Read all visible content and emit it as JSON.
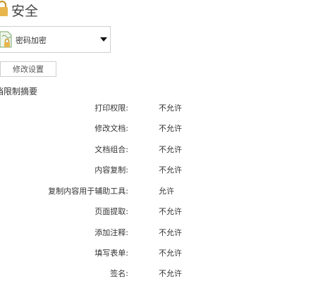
{
  "header": {
    "icon": "lock-icon",
    "title": "安全"
  },
  "security_method": {
    "icon": "document-lock-icon",
    "selected": "密码加密",
    "caret_icon": "caret-down-icon"
  },
  "modify_button": {
    "label": "修改设置"
  },
  "summary": {
    "heading": "档限制摘要",
    "rows": [
      {
        "label": "打印权限:",
        "value": "不允许"
      },
      {
        "label": "修改文档:",
        "value": "不允许"
      },
      {
        "label": "文档组合:",
        "value": "不允许"
      },
      {
        "label": "内容复制:",
        "value": "不允许"
      },
      {
        "label": "复制内容用于辅助工具:",
        "value": "允许"
      },
      {
        "label": "页面提取:",
        "value": "不允许"
      },
      {
        "label": "添加注释:",
        "value": "不允许"
      },
      {
        "label": "填写表单:",
        "value": "不允许"
      },
      {
        "label": "签名:",
        "value": "不允许"
      }
    ]
  },
  "colors": {
    "lock_gold": "#e8b64c",
    "border": "#cfcfcf",
    "text": "#333333"
  }
}
